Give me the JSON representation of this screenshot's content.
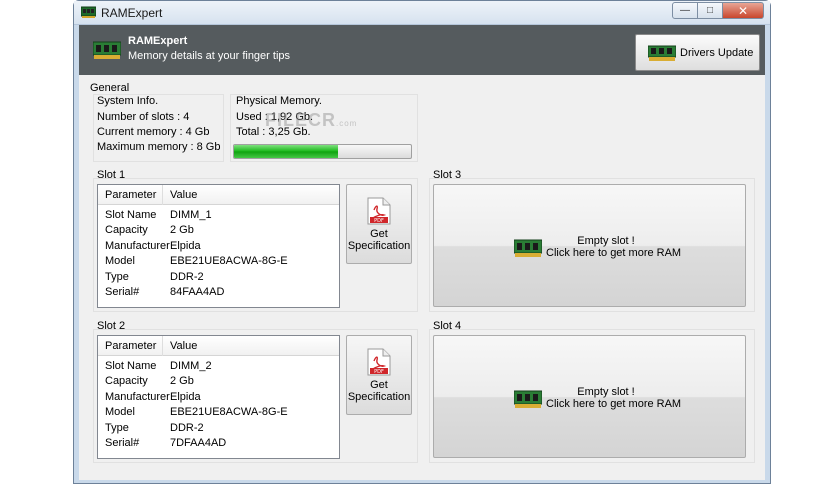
{
  "window": {
    "title": "RAMExpert",
    "minimize_glyph": "—",
    "maximize_glyph": "□",
    "close_glyph": "✕"
  },
  "header": {
    "title": "RAMExpert",
    "subtitle": "Memory details at your finger tips",
    "drivers_button": "Drivers Update",
    "bg_color": "#555b5e"
  },
  "general": {
    "label": "General",
    "system_info": {
      "label": "System Info.",
      "slots": "Number of slots : 4",
      "current": "Current memory : 4 Gb",
      "maximum": "Maximum memory : 8 Gb"
    },
    "physical": {
      "label": "Physical Memory.",
      "used": "Used : 1,92 Gb.",
      "total": "Total : 3,25 Gb.",
      "usage_fraction": 0.59,
      "bar_color": "#18b818"
    }
  },
  "watermark": {
    "text": "FILECR",
    "suffix": ".com"
  },
  "table_headers": {
    "parameter": "Parameter",
    "value": "Value"
  },
  "spec_button": {
    "line1": "Get",
    "line2": "Specification",
    "icon_label": "PDF"
  },
  "empty_slot": {
    "line1": "Empty slot !",
    "line2": "Click here to get more RAM"
  },
  "slots": [
    {
      "label": "Slot 1",
      "rows": [
        [
          "Slot Name",
          "DIMM_1"
        ],
        [
          "Capacity",
          "2 Gb"
        ],
        [
          "Manufacturer",
          "Elpida"
        ],
        [
          "Model",
          "EBE21UE8ACWA-8G-E"
        ],
        [
          "Type",
          "DDR-2"
        ],
        [
          "Serial#",
          "84FAA4AD"
        ]
      ]
    },
    {
      "label": "Slot 2",
      "rows": [
        [
          "Slot Name",
          "DIMM_2"
        ],
        [
          "Capacity",
          "2 Gb"
        ],
        [
          "Manufacturer",
          "Elpida"
        ],
        [
          "Model",
          "EBE21UE8ACWA-8G-E"
        ],
        [
          "Type",
          "DDR-2"
        ],
        [
          "Serial#",
          "7DFAA4AD"
        ]
      ]
    },
    {
      "label": "Slot 3"
    },
    {
      "label": "Slot 4"
    }
  ]
}
